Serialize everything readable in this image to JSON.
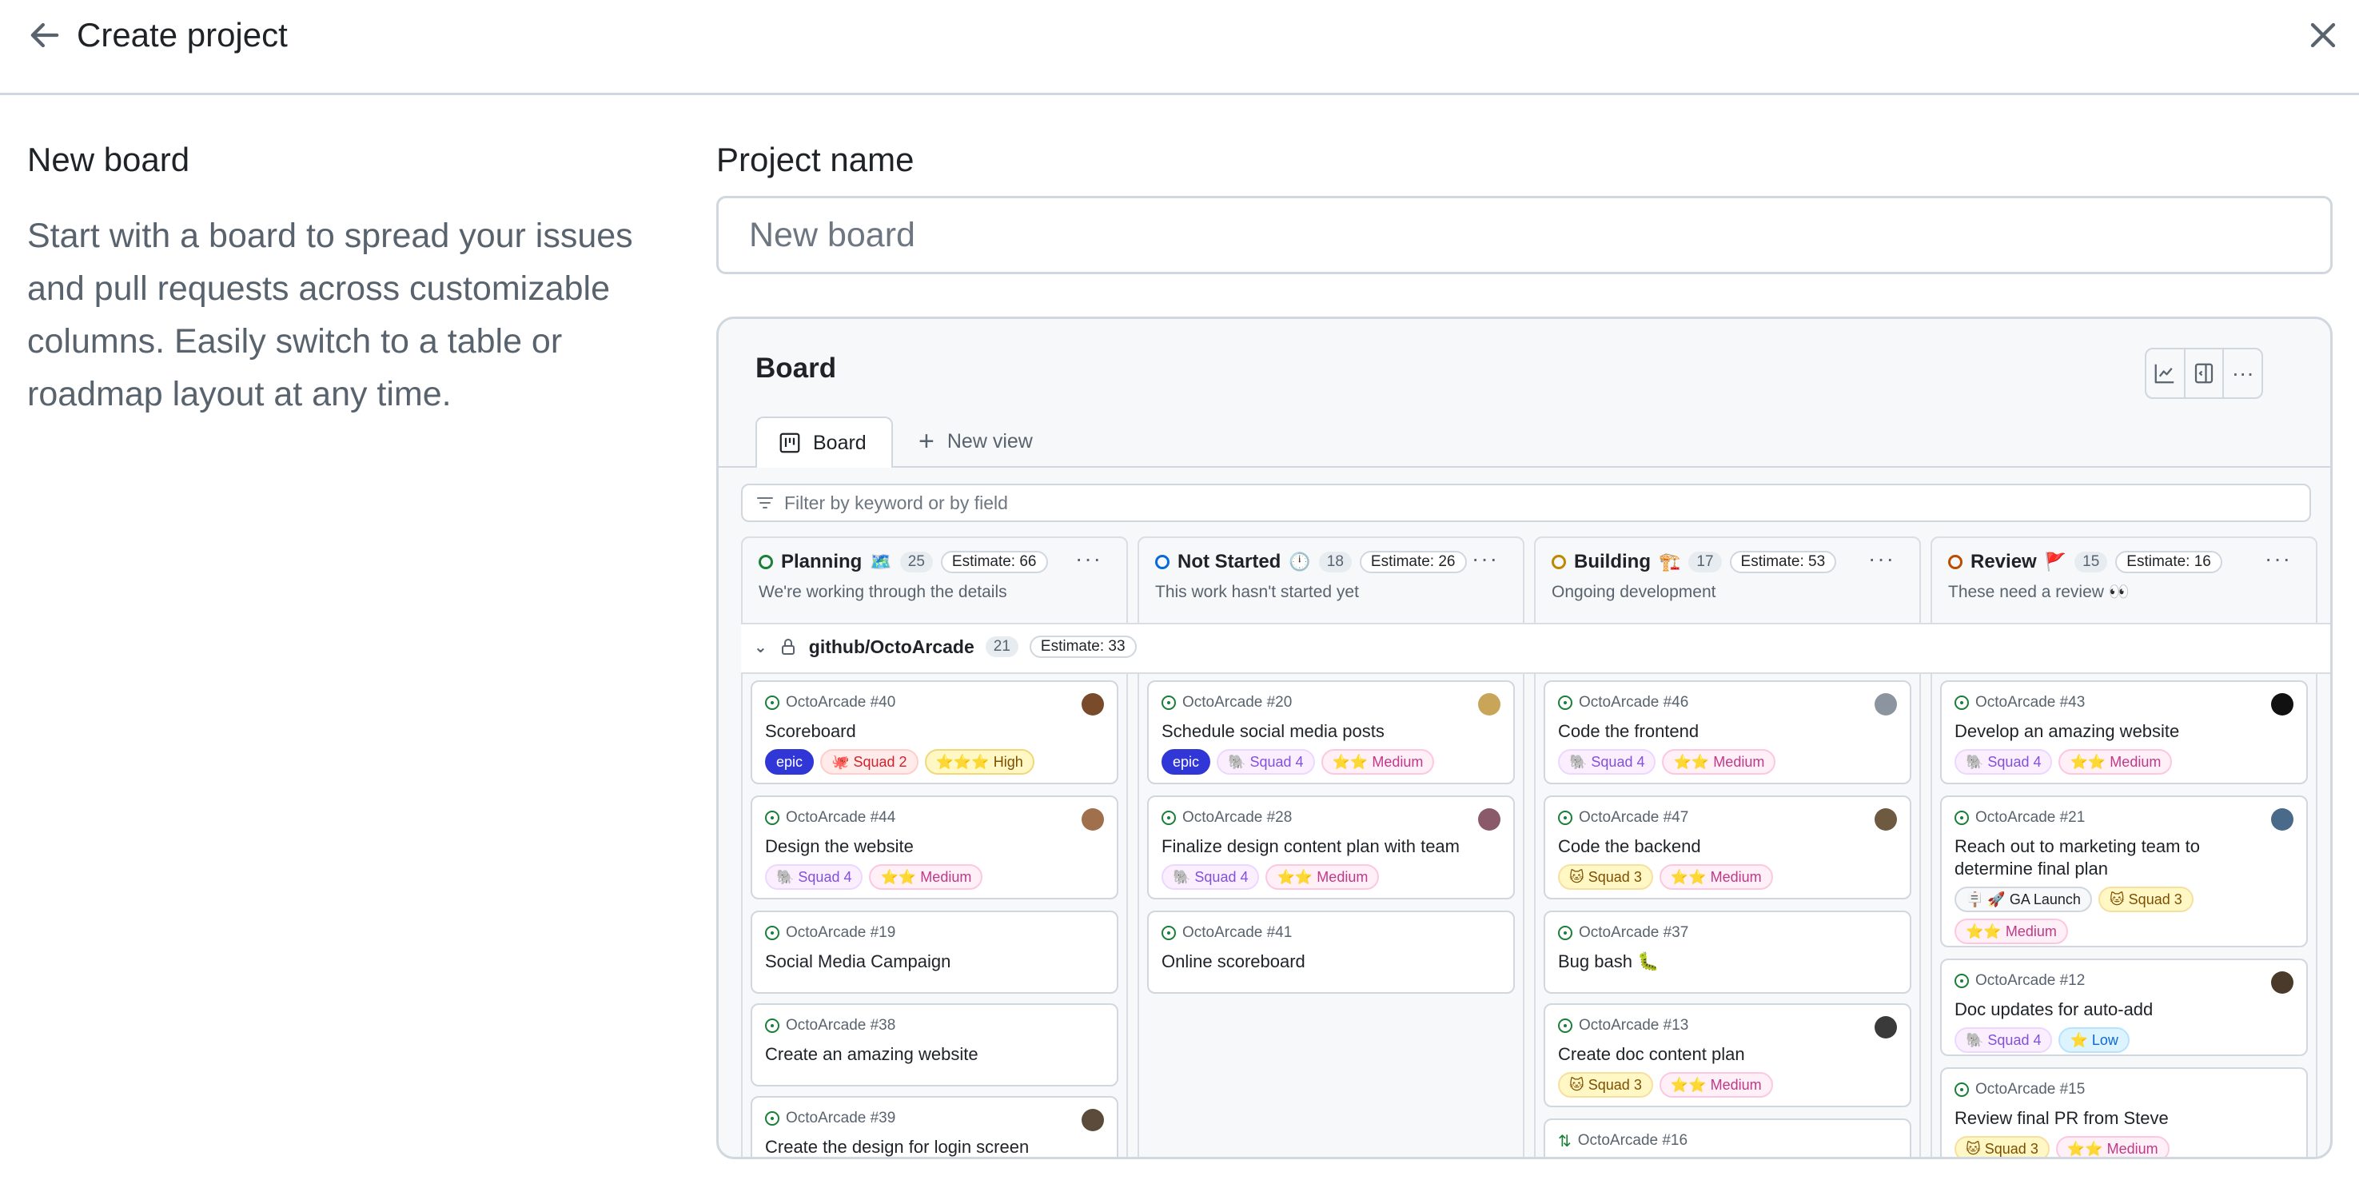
{
  "header": {
    "title": "Create project"
  },
  "description": {
    "title": "New board",
    "body": "Start with a board to spread your issues and pull requests across customizable columns. Easily switch to a table or roadmap layout at any time."
  },
  "form": {
    "label": "Project name",
    "placeholder": "New board"
  },
  "preview": {
    "title": "Board",
    "tabs": {
      "board": "Board",
      "new_view": "New view"
    },
    "filter_placeholder": "Filter by keyword or by field",
    "group": {
      "name": "github/OctoArcade",
      "count": "21",
      "estimate": "Estimate: 33"
    },
    "columns": [
      {
        "name": "Planning",
        "emoji": "🗺️",
        "count": "25",
        "estimate": "Estimate: 66",
        "description": "We're working through the details",
        "color": "#1a7f37",
        "cards": [
          {
            "ref": "OctoArcade #40",
            "title": "Scoreboard",
            "avatar": "#7a4b2a",
            "labels": [
              {
                "text": "epic",
                "kind": "epic"
              },
              {
                "text": "🐙 Squad 2",
                "kind": "squad2"
              },
              {
                "text": "⭐⭐⭐ High",
                "kind": "high"
              }
            ]
          },
          {
            "ref": "OctoArcade #44",
            "title": "Design the website",
            "avatar": "#a0704c",
            "labels": [
              {
                "text": "🐘 Squad 4",
                "kind": "squad4"
              },
              {
                "text": "⭐⭐ Medium",
                "kind": "medium"
              }
            ]
          },
          {
            "ref": "OctoArcade #19",
            "title": "Social Media Campaign",
            "labels": []
          },
          {
            "ref": "OctoArcade #38",
            "title": "Create an amazing website",
            "labels": []
          },
          {
            "ref": "OctoArcade #39",
            "title": "Create the design for login screen",
            "avatar": "#5c4a3a",
            "labels": []
          }
        ]
      },
      {
        "name": "Not Started",
        "emoji": "🕛",
        "count": "18",
        "estimate": "Estimate: 26",
        "description": "This work hasn't started yet",
        "color": "#0969da",
        "cards": [
          {
            "ref": "OctoArcade #20",
            "title": "Schedule social media posts",
            "avatar": "#c9a55a",
            "labels": [
              {
                "text": "epic",
                "kind": "epic"
              },
              {
                "text": "🐘 Squad 4",
                "kind": "squad4"
              },
              {
                "text": "⭐⭐ Medium",
                "kind": "medium"
              }
            ]
          },
          {
            "ref": "OctoArcade #28",
            "title": "Finalize design content plan with team",
            "avatar": "#8a5a6a",
            "labels": [
              {
                "text": "🐘 Squad 4",
                "kind": "squad4"
              },
              {
                "text": "⭐⭐ Medium",
                "kind": "medium"
              }
            ]
          },
          {
            "ref": "OctoArcade #41",
            "title": "Online scoreboard",
            "labels": []
          }
        ]
      },
      {
        "name": "Building",
        "emoji": "🏗️",
        "count": "17",
        "estimate": "Estimate: 53",
        "description": "Ongoing development",
        "color": "#bf8700",
        "cards": [
          {
            "ref": "OctoArcade #46",
            "title": "Code the frontend",
            "avatar": "#8c959f",
            "labels": [
              {
                "text": "🐘 Squad 4",
                "kind": "squad4"
              },
              {
                "text": "⭐⭐ Medium",
                "kind": "medium"
              }
            ]
          },
          {
            "ref": "OctoArcade #47",
            "title": "Code the backend",
            "avatar": "#6e5a40",
            "labels": [
              {
                "text": "🐱 Squad 3",
                "kind": "squad3"
              },
              {
                "text": "⭐⭐ Medium",
                "kind": "medium"
              }
            ]
          },
          {
            "ref": "OctoArcade #37",
            "title": "Bug bash 🐛",
            "labels": []
          },
          {
            "ref": "OctoArcade #13",
            "title": "Create doc content plan",
            "avatar": "#3a3a3a",
            "labels": [
              {
                "text": "🐱 Squad 3",
                "kind": "squad3"
              },
              {
                "text": "⭐⭐ Medium",
                "kind": "medium"
              }
            ]
          },
          {
            "ref": "OctoArcade #16",
            "title": "",
            "pr": true,
            "labels": []
          }
        ]
      },
      {
        "name": "Review",
        "emoji": "🚩",
        "count": "15",
        "estimate": "Estimate: 16",
        "description": "These need a review 👀",
        "color": "#bc4c00",
        "cards": [
          {
            "ref": "OctoArcade #43",
            "title": "Develop an amazing website",
            "avatar": "#111111",
            "labels": [
              {
                "text": "🐘 Squad 4",
                "kind": "squad4"
              },
              {
                "text": "⭐⭐ Medium",
                "kind": "medium"
              }
            ]
          },
          {
            "ref": "OctoArcade #21",
            "title": "Reach out to marketing team to determine final plan",
            "avatar": "#4a6a8a",
            "labels": [
              {
                "text": "🪧 🚀 GA Launch",
                "kind": "ga"
              },
              {
                "text": "🐱 Squad 3",
                "kind": "squad3"
              },
              {
                "text": "⭐⭐ Medium",
                "kind": "medium"
              }
            ]
          },
          {
            "ref": "OctoArcade #12",
            "title": "Doc updates for auto-add",
            "avatar": "#4a3a2a",
            "labels": [
              {
                "text": "🐘 Squad 4",
                "kind": "squad4"
              },
              {
                "text": "⭐ Low",
                "kind": "low"
              }
            ]
          },
          {
            "ref": "OctoArcade #15",
            "title": "Review final PR from Steve",
            "labels": [
              {
                "text": "🐱 Squad 3",
                "kind": "squad3"
              },
              {
                "text": "⭐⭐ Medium",
                "kind": "medium"
              }
            ]
          }
        ]
      }
    ]
  },
  "icons": {
    "back": "arrow-left-icon",
    "close": "x-icon"
  }
}
